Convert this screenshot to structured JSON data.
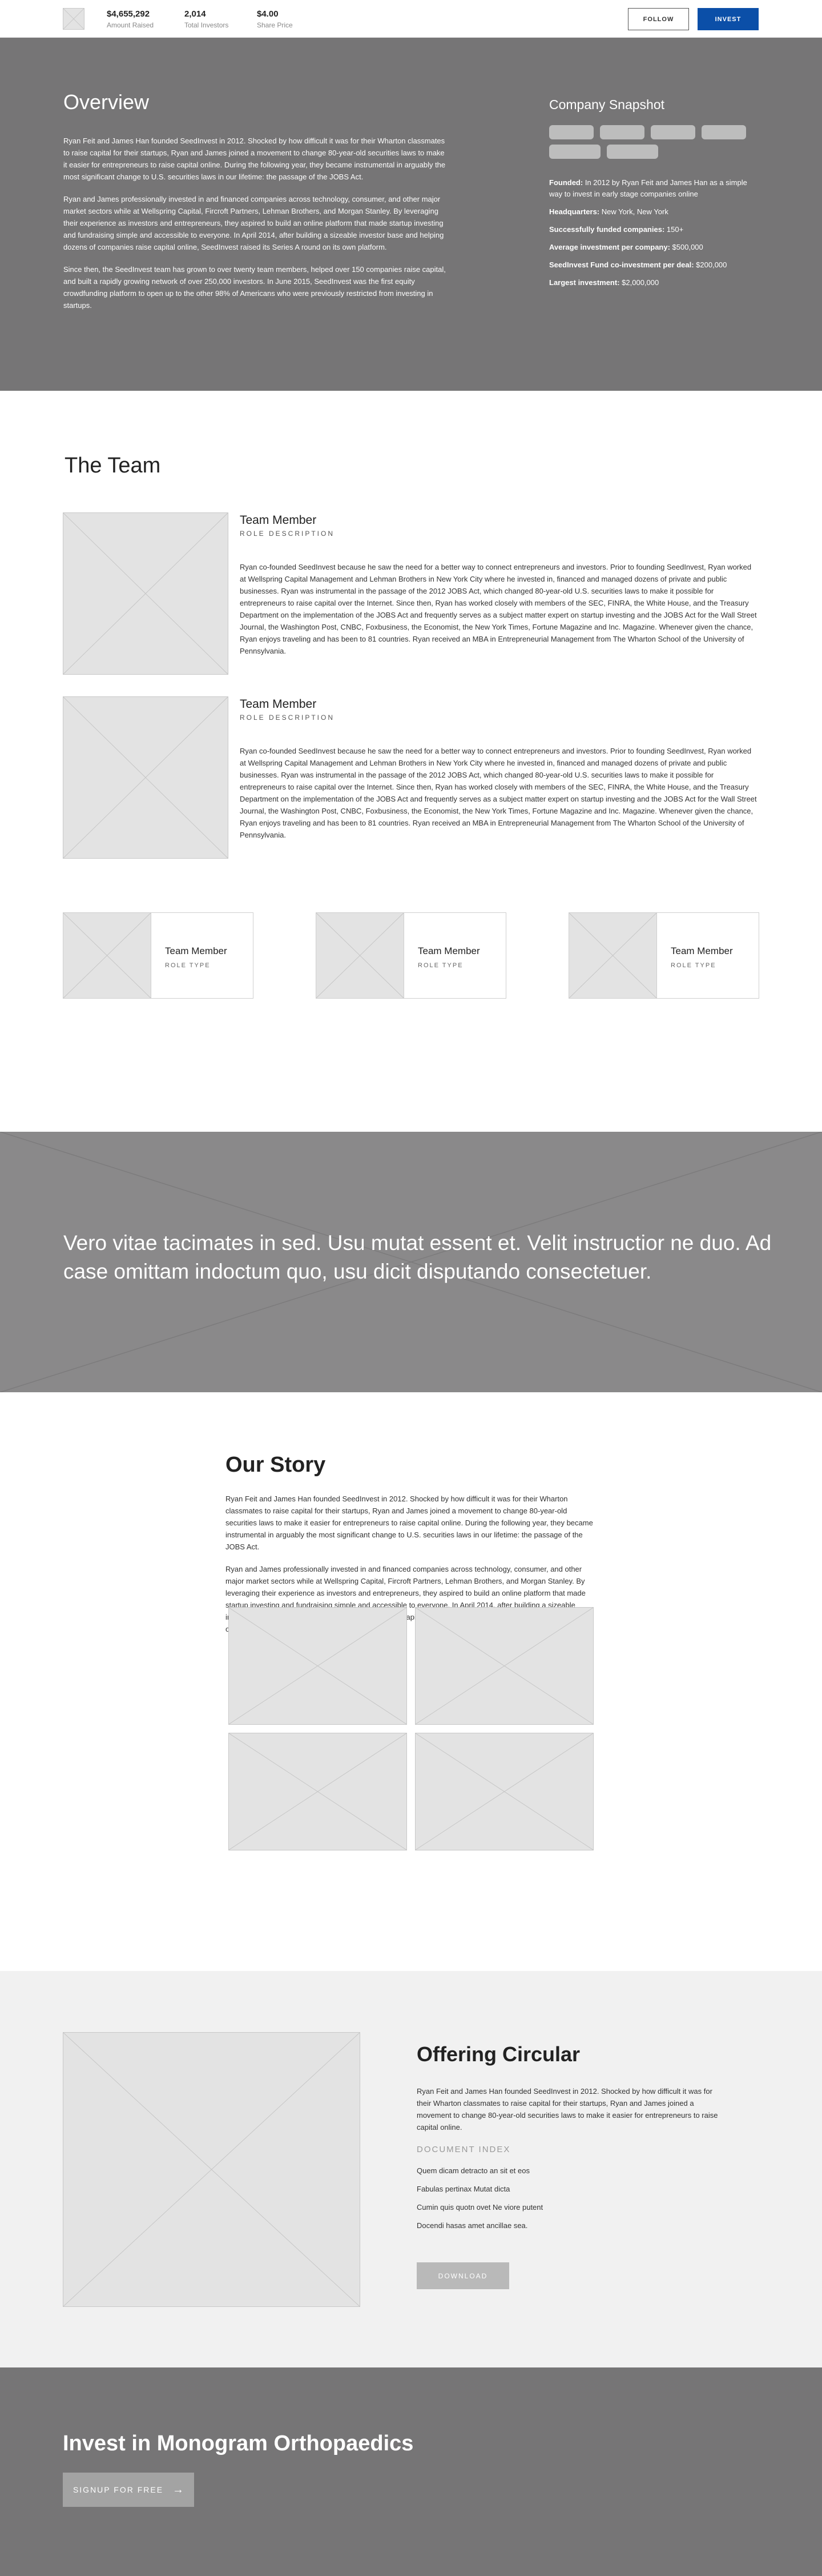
{
  "header": {
    "stats": [
      {
        "value": "$4,655,292",
        "label": "Amount Raised"
      },
      {
        "value": "2,014",
        "label": "Total Investors"
      },
      {
        "value": "$4.00",
        "label": "Share Price"
      }
    ],
    "follow_label": "FOLLOW",
    "invest_label": "INVEST",
    "invest_color": "#0b4fa8"
  },
  "overview": {
    "title": "Overview",
    "paragraphs": [
      "Ryan Feit and James Han founded SeedInvest in 2012. Shocked by how difficult it was for their Wharton classmates to raise capital for their startups, Ryan and James joined a movement to change 80-year-old securities laws to make it easier for entrepreneurs to raise capital online. During the following year, they became instrumental in arguably the most significant change to U.S. securities laws in our lifetime: the passage of the JOBS Act.",
      "Ryan and James professionally invested in and financed companies across technology, consumer, and other major market sectors while at Wellspring Capital, Fircroft Partners, Lehman Brothers, and Morgan Stanley. By leveraging their experience as investors and entrepreneurs, they aspired to build an online platform that made startup investing and fundraising simple and accessible to everyone. In April 2014, after building a sizeable investor base and helping dozens of companies raise capital online, SeedInvest raised its Series A round on its own platform.",
      "Since then, the SeedInvest team has grown to over twenty team members, helped over 150 companies raise capital, and built a rapidly growing network of over 250,000 investors. In June 2015, SeedInvest was the first equity crowdfunding platform to open up to the other 98% of Americans who were previously restricted from investing in startups."
    ]
  },
  "snapshot": {
    "title": "Company Snapshot",
    "facts": [
      {
        "label": "Founded:",
        "value": " In 2012 by Ryan Feit and James Han as a simple way to invest in early stage companies online"
      },
      {
        "label": "Headquarters:",
        "value": " New York, New York"
      },
      {
        "label": "Successfully funded companies:",
        "value": " 150+"
      },
      {
        "label": "Average investment per company:",
        "value": " $500,000"
      },
      {
        "label": "SeedInvest Fund co-investment per deal:",
        "value": " $200,000"
      },
      {
        "label": "Largest investment:",
        "value": " $2,000,000"
      }
    ]
  },
  "team": {
    "title": "The Team",
    "members": [
      {
        "name": "Team Member",
        "role": "ROLE DESCRIPTION",
        "bio": "Ryan co-founded SeedInvest because he saw the need for a better way to connect entrepreneurs and investors. Prior to founding SeedInvest, Ryan worked at Wellspring Capital Management and Lehman Brothers in New York City where he invested in, financed and managed dozens of private and public businesses. Ryan was instrumental in the passage of the 2012 JOBS Act, which changed 80-year-old U.S. securities laws to make it possible for entrepreneurs to raise capital over the Internet. Since then, Ryan has worked closely with members of the SEC, FINRA, the White House, and the Treasury Department on the implementation of the JOBS Act and frequently serves as a subject matter expert on startup investing and the JOBS Act for the Wall Street Journal, the Washington Post, CNBC, Foxbusiness, the Economist, the New York Times, Fortune Magazine and Inc. Magazine. Whenever given the chance, Ryan enjoys traveling and has been to 81 countries. Ryan received an MBA in Entrepreneurial Management from The Wharton School of the University of Pennsylvania."
      },
      {
        "name": "Team Member",
        "role": "ROLE DESCRIPTION",
        "bio": "Ryan co-founded SeedInvest because he saw the need for a better way to connect entrepreneurs and investors. Prior to founding SeedInvest, Ryan worked at Wellspring Capital Management and Lehman Brothers in New York City where he invested in, financed and managed dozens of private and public businesses. Ryan was instrumental in the passage of the 2012 JOBS Act, which changed 80-year-old U.S. securities laws to make it possible for entrepreneurs to raise capital over the Internet. Since then, Ryan has worked closely with members of the SEC, FINRA, the White House, and the Treasury Department on the implementation of the JOBS Act and frequently serves as a subject matter expert on startup investing and the JOBS Act for the Wall Street Journal, the Washington Post, CNBC, Foxbusiness, the Economist, the New York Times, Fortune Magazine and Inc. Magazine. Whenever given the chance, Ryan enjoys traveling and has been to 81 countries. Ryan received an MBA in Entrepreneurial Management from The Wharton School of the University of Pennsylvania."
      }
    ],
    "cards": [
      {
        "name": "Team Member",
        "role": "ROLE TYPE"
      },
      {
        "name": "Team Member",
        "role": "ROLE TYPE"
      },
      {
        "name": "Team Member",
        "role": "ROLE TYPE"
      }
    ]
  },
  "quote": {
    "text": "Vero vitae tacimates in sed. Usu mutat essent et. Velit instructior ne duo. Ad case omittam indoctum quo, usu dicit disputando consectetuer."
  },
  "story": {
    "title": "Our Story",
    "paragraphs": [
      "Ryan Feit and James Han founded SeedInvest in 2012. Shocked by how difficult it was for their Wharton classmates to raise capital for their startups, Ryan and James joined a movement to change 80-year-old securities laws to make it easier for entrepreneurs to raise capital online. During the following year, they became instrumental in arguably the most significant change to U.S. securities laws in our lifetime: the passage of the JOBS Act.",
      "Ryan and James professionally invested in and financed companies across technology, consumer, and other major market sectors while at Wellspring Capital, Fircroft Partners, Lehman Brothers, and Morgan Stanley. By leveraging their experience as investors and entrepreneurs, they aspired to build an online platform that made startup investing and fundraising simple and accessible to everyone. In April 2014, after building a sizeable investor base and helping dozens of companies raise capital online, SeedInvest raised its Series A round on its own platform."
    ]
  },
  "offering": {
    "title": "Offering Circular",
    "paragraph": "Ryan Feit and James Han founded SeedInvest in 2012. Shocked by how difficult it was for their Wharton classmates to raise capital for their startups, Ryan and James joined a movement to change 80-year-old securities laws to make it easier for entrepreneurs to raise capital online.",
    "index_heading": "DOCUMENT INDEX",
    "index_items": [
      "Quem dicam detracto an sit et eos",
      "Fabulas pertinax Mutat dicta",
      "Cumin quis quotn ovet Ne viore putent",
      "Docendi hasas amet ancillae sea."
    ],
    "download_label": "DOWNLOAD"
  },
  "footer": {
    "title": "Invest in Monogram Orthopaedics",
    "signup_label": "SIGNUP FOR FREE",
    "arrow_icon": "arrow-right-icon"
  }
}
